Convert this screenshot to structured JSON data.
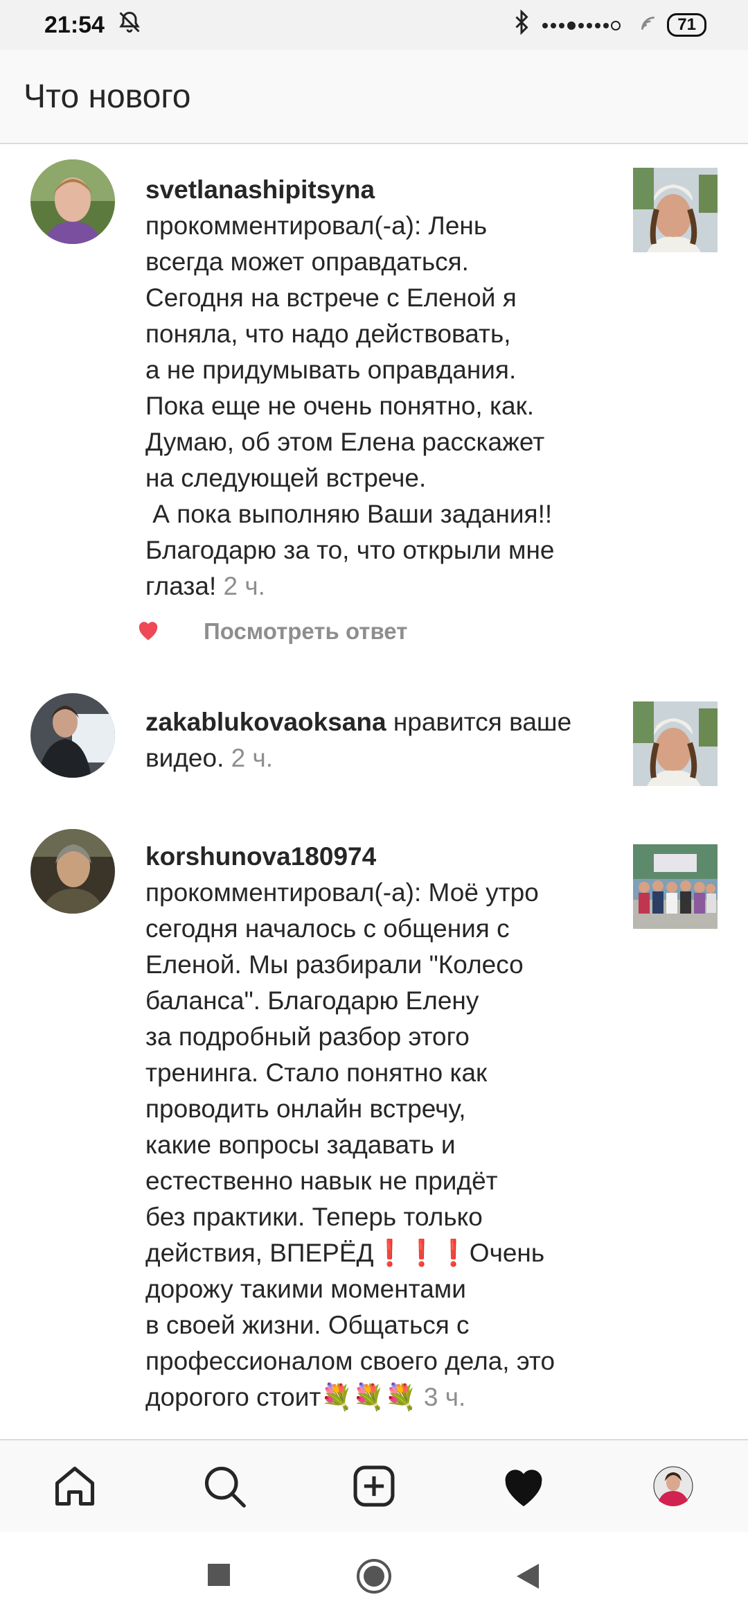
{
  "status": {
    "time": "21:54",
    "battery": "71",
    "mute_icon": "bell-off-icon",
    "bluetooth_icon": "bluetooth-icon",
    "signal_icon": "signal-icon",
    "wifi_icon": "wifi-icon"
  },
  "header": {
    "title": "Что нового"
  },
  "notifications": [
    {
      "username": "svetlanashipitsyna",
      "text": "прокомментировал(-а): Лень\nвсегда может оправдаться.\nСегодня на встрече с Еленой я\nпоняла, что надо действовать,\nа не придумывать оправдания.\nПока еще не очень понятно, как.\nДумаю, об этом Елена расскажет\nна следующей встрече.\n А пока выполняю Ваши задания!!\nБлагодарю за то, что открыли мне\nглаза!",
      "time": "2 ч.",
      "reply_label": "Посмотреть ответ"
    },
    {
      "username": "zakablukovaoksana",
      "text": "нравится ваше\nвидео.",
      "time": "2 ч."
    },
    {
      "username": "korshunova180974",
      "text": "прокомментировал(-а): Моё утро\nсегодня началось с общения с\nЕленой. Мы разбирали \"Колесо\nбаланса\". Благодарю Елену\nза подробный разбор этого\nтренинга. Стало понятно как\nпроводить онлайн встречу,\nкакие вопросы задавать и\nестественно навык не придёт\nбез практики. Теперь только\nдействия, ВПЕРЁД❗❗❗Очень\nдорожу такими моментами\nв своей жизни. Общаться с\nпрофессионалом своего дела, это\nдорогого стоит💐💐💐",
      "time": "3 ч."
    }
  ],
  "nav": {
    "home_icon": "home-icon",
    "search_icon": "search-icon",
    "add_icon": "add-post-icon",
    "activity_icon": "heart-icon",
    "profile_icon": "profile-avatar"
  },
  "colors": {
    "like_red": "#ed4956",
    "muted_text": "#8e8e8e",
    "text": "#262626"
  }
}
